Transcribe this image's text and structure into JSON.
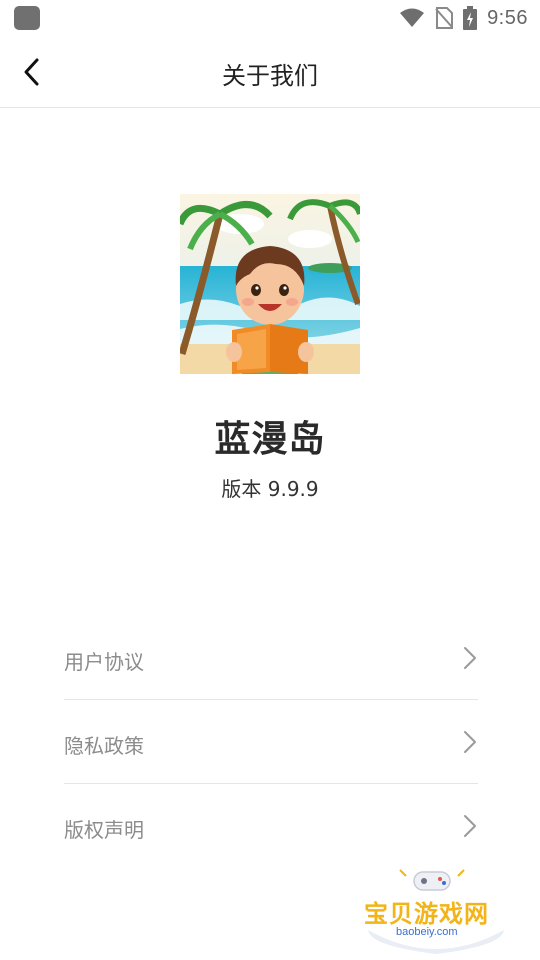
{
  "status_bar": {
    "time": "9:56",
    "icons": [
      "app-notification-icon",
      "wifi-icon",
      "no-sim-icon",
      "battery-charging-icon"
    ]
  },
  "header": {
    "title": "关于我们",
    "back_icon": "chevron-left-icon"
  },
  "app": {
    "name": "蓝漫岛",
    "version": "版本 9.9.9",
    "icon": "app-logo-boy-reading-on-beach"
  },
  "menu": {
    "items": [
      {
        "label": "用户协议",
        "icon": "chevron-right-icon"
      },
      {
        "label": "隐私政策",
        "icon": "chevron-right-icon"
      },
      {
        "label": "版权声明",
        "icon": "chevron-right-icon"
      }
    ]
  },
  "watermark": {
    "title": "宝贝游戏网",
    "subtitle": "baobeiy.com"
  },
  "colors": {
    "title_text": "#222222",
    "menu_text": "#8c8c8c",
    "divider": "#e6e6e6",
    "watermark_gold": "#f2b418",
    "watermark_blue": "#3b6fd1"
  }
}
